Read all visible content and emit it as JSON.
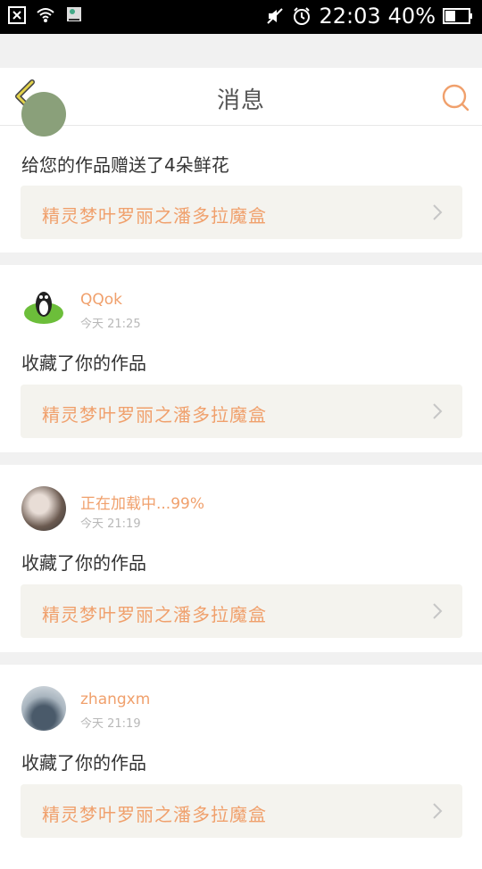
{
  "status_bar": {
    "time": "22:03",
    "battery": "40%",
    "icons": [
      "notification-dismiss-icon",
      "wifi-icon",
      "download-icon",
      "mute-icon",
      "alarm-icon",
      "battery-icon"
    ]
  },
  "header": {
    "title": "消息",
    "back_icon": "back-arrow-icon",
    "search_icon": "search-icon"
  },
  "messages": [
    {
      "name": "",
      "time": "",
      "text": "给您的作品赠送了4朵鲜花",
      "work_title": "精灵梦叶罗丽之潘多拉魔盒"
    },
    {
      "name": "QQok",
      "time": "今天 21:25",
      "text": "收藏了你的作品",
      "work_title": "精灵梦叶罗丽之潘多拉魔盒"
    },
    {
      "name": "正在加载中...99%",
      "time": "今天 21:19",
      "text": "收藏了你的作品",
      "work_title": "精灵梦叶罗丽之潘多拉魔盒"
    },
    {
      "name": "zhangxm",
      "time": "今天 21:19",
      "text": "收藏了你的作品",
      "work_title": "精灵梦叶罗丽之潘多拉魔盒"
    }
  ],
  "colors": {
    "accent": "#f0a06c",
    "back_arrow": "#e2d24a",
    "background": "#f1f1f1",
    "work_bg": "#f4f3ee"
  }
}
